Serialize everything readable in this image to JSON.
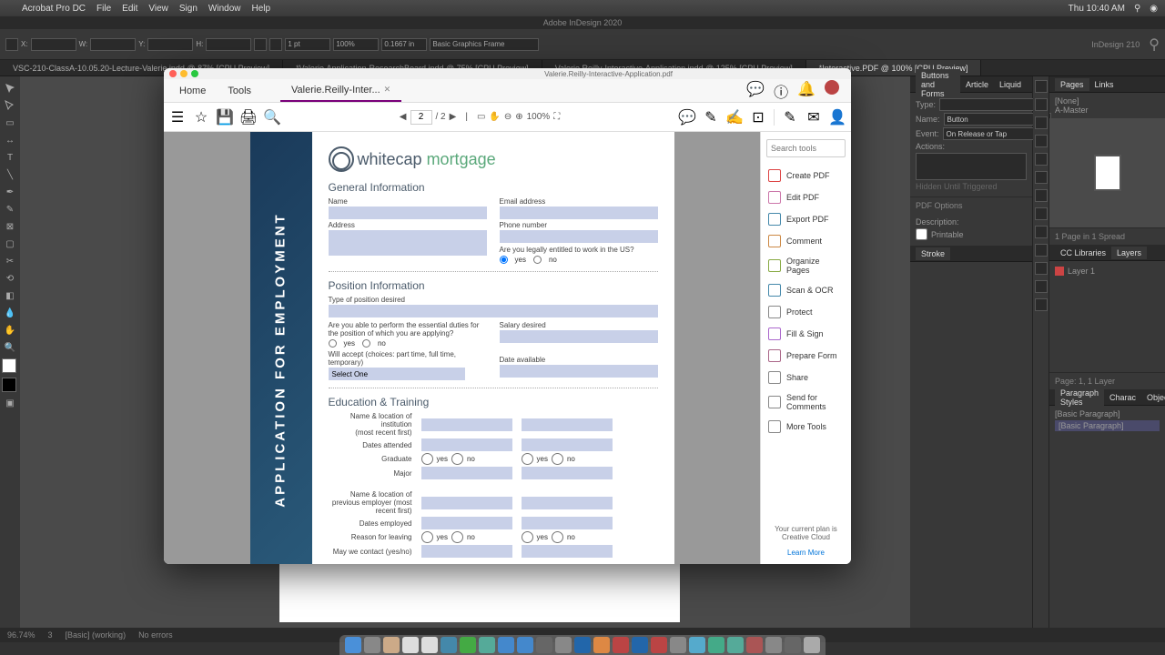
{
  "menubar": {
    "app": "Acrobat Pro DC",
    "items": [
      "File",
      "Edit",
      "View",
      "Sign",
      "Window",
      "Help"
    ],
    "time": "Thu 10:40 AM"
  },
  "appTitlebar": "Adobe InDesign 2020",
  "controlBar": {
    "stroke": "1 pt",
    "scale": "100%",
    "dim": "0.1667 in",
    "frame": "Basic Graphics Frame"
  },
  "docTabs": [
    "VSC-210-ClassA-10.05.20-Lecture-Valerie.indd @ 87% [CPU Preview]",
    "*Valerie.Application-ResearchBoard.indd @ 75% [CPU Preview]",
    "Valerie.Reilly-Interactive-Application.indd @ 125% [CPU Preview]",
    "*Interactive.PDF @ 100% [CPU Preview]"
  ],
  "rightPanels": {
    "buttons": {
      "tabs": [
        "Buttons and Forms",
        "Article",
        "Liquid"
      ],
      "typeLabel": "Type:",
      "nameLabel": "Name:",
      "nameVal": "Button",
      "eventLabel": "Event:",
      "eventVal": "On Release or Tap",
      "actionsLabel": "Actions:",
      "hidden": "Hidden Until Triggered",
      "pdfOpts": "PDF Options",
      "desc": "Description:",
      "printable": "Printable"
    },
    "stroke": "Stroke",
    "pages": {
      "tabs": [
        "Pages",
        "Links"
      ],
      "none": "[None]",
      "master": "A-Master",
      "info": "1 Page in 1 Spread"
    },
    "layers": {
      "tabs": [
        "CC Libraries",
        "Layers"
      ],
      "layer": "Layer 1"
    },
    "para": {
      "tabs": [
        "Paragraph Styles",
        "Charac",
        "Object"
      ],
      "basic": "[Basic Paragraph]",
      "basic2": "[Basic Paragraph]"
    },
    "pageInfo": "Page: 1, 1 Layer"
  },
  "statusBar": {
    "zoom": "96.74%",
    "page": "3",
    "basic": "[Basic] (working)",
    "err": "No errors"
  },
  "acrobat": {
    "title": "Valerie.Reilly-Interactive-Application.pdf",
    "navTabs": [
      "Home",
      "Tools"
    ],
    "fileTab": "Valerie.Reilly-Inter...",
    "pageCtrl": {
      "cur": "2",
      "of": "/ 2"
    },
    "zoom": "100%",
    "searchPlaceholder": "Search tools",
    "rightTools": [
      {
        "label": "Create PDF",
        "color": "#d44"
      },
      {
        "label": "Edit PDF",
        "color": "#c7a"
      },
      {
        "label": "Export PDF",
        "color": "#48a"
      },
      {
        "label": "Comment",
        "color": "#c84"
      },
      {
        "label": "Organize Pages",
        "color": "#8a4"
      },
      {
        "label": "Scan & OCR",
        "color": "#48a"
      },
      {
        "label": "Protect",
        "color": "#888"
      },
      {
        "label": "Fill & Sign",
        "color": "#a6c"
      },
      {
        "label": "Prepare Form",
        "color": "#a68"
      },
      {
        "label": "Share",
        "color": "#888"
      },
      {
        "label": "Send for Comments",
        "color": "#888"
      },
      {
        "label": "More Tools",
        "color": "#888"
      }
    ],
    "plan": "Your current plan is Creative Cloud",
    "learn": "Learn More"
  },
  "form": {
    "logo1": "whitecap",
    "logo2": "mortgage",
    "sidebarText": "APPLICATION FOR EMPLOYMENT",
    "sec1": "General Information",
    "name": "Name",
    "email": "Email address",
    "address": "Address",
    "phone": "Phone number",
    "legal": "Are you legally entitled to work in the US?",
    "yes": "yes",
    "no": "no",
    "sec2": "Position Information",
    "posType": "Type of position desired",
    "duties": "Are you able to perform the essential duties for the position of which you are applying?",
    "salary": "Salary desired",
    "accept": "Will accept",
    "acceptChoices": "(choices: part time, full time, temporary)",
    "selectOne": "Select One",
    "dateAvail": "Date available",
    "sec3": "Education & Training",
    "inst": "Name & location of institution",
    "recent": "(most recent first)",
    "dates": "Dates attended",
    "grad": "Graduate",
    "major": "Major",
    "prev": "Name & location of previous employer (most recent first)",
    "empDates": "Dates employed",
    "reason": "Reason for leaving",
    "contact": "May we contact (yes/no)"
  }
}
